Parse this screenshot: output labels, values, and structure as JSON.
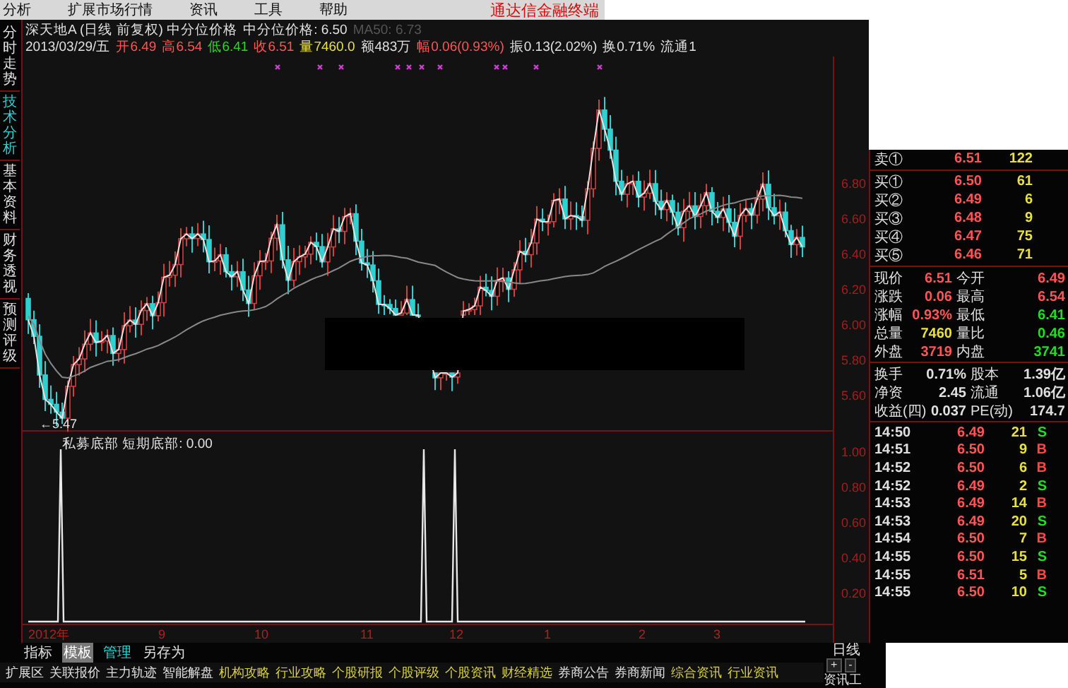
{
  "menu": {
    "items": [
      "分析",
      "扩展市场行情",
      "资讯",
      "工具",
      "帮助"
    ],
    "brand": "通达信金融终端"
  },
  "side_tabs": [
    {
      "label": "分时走势",
      "selected": false
    },
    {
      "label": "技术分析",
      "selected": true
    },
    {
      "label": "基本资料",
      "selected": false
    },
    {
      "label": "财务透视",
      "selected": false
    },
    {
      "label": "预测评级",
      "selected": false
    }
  ],
  "chart": {
    "title": "深天地A (日线 前复权) 中分位价格",
    "indicator_label": "中分位价格: 6.50",
    "ma_label": "MA50: 6.73",
    "bar_info": [
      {
        "text": "2013/03/29/五",
        "kind": "plain"
      },
      {
        "text": "开6.49",
        "kind": "up"
      },
      {
        "text": "高6.54",
        "kind": "up"
      },
      {
        "text": "低6.41",
        "kind": "down"
      },
      {
        "text": "收6.51",
        "kind": "up"
      },
      {
        "text": "量7460.0",
        "kind": "volume"
      },
      {
        "text": "额483万",
        "kind": "plain"
      },
      {
        "text": "幅0.06(0.93%)",
        "kind": "up"
      },
      {
        "text": "振0.13(2.02%)",
        "kind": "plain"
      },
      {
        "text": "换0.71%",
        "kind": "plain"
      },
      {
        "text": "流通1",
        "kind": "plain"
      }
    ],
    "price_ticks": [
      "6.80",
      "6.60",
      "6.40",
      "6.20",
      "6.00",
      "5.80",
      "5.60"
    ],
    "low_marker": "←5.47"
  },
  "indicator": {
    "title": "私募底部 短期底部: 0.00",
    "ticks": [
      "1.00",
      "0.80",
      "0.60",
      "0.40",
      "0.20"
    ]
  },
  "date_axis": [
    "2012年",
    "9",
    "10",
    "11",
    "12",
    "1",
    "2",
    "3"
  ],
  "chart_tabs": [
    {
      "label": "指标",
      "selected": false,
      "kind": "tab"
    },
    {
      "label": "模板",
      "selected": true,
      "kind": "tab"
    },
    {
      "label": "管理",
      "selected": false,
      "kind": "link"
    },
    {
      "label": "另存为",
      "selected": false,
      "kind": "tab"
    }
  ],
  "period": "日线",
  "zoom_buttons": [
    "+",
    "-"
  ],
  "asks": [
    {
      "label": "卖①",
      "price": "6.51",
      "volume": "122"
    }
  ],
  "bids": [
    {
      "label": "买①",
      "price": "6.50",
      "volume": "61"
    },
    {
      "label": "买②",
      "price": "6.49",
      "volume": "6"
    },
    {
      "label": "买③",
      "price": "6.48",
      "volume": "9"
    },
    {
      "label": "买④",
      "price": "6.47",
      "volume": "75"
    },
    {
      "label": "买⑤",
      "price": "6.46",
      "volume": "71"
    }
  ],
  "stats": [
    {
      "label": "现价",
      "value": "6.51",
      "color": "#ff5555"
    },
    {
      "label": "今开",
      "value": "6.49",
      "color": "#ff5555"
    },
    {
      "label": "涨跌",
      "value": "0.06",
      "color": "#ff5555"
    },
    {
      "label": "最高",
      "value": "6.54",
      "color": "#ff5555"
    },
    {
      "label": "涨幅",
      "value": "0.93%",
      "color": "#ff5555"
    },
    {
      "label": "最低",
      "value": "6.41",
      "color": "#22dd22"
    },
    {
      "label": "总量",
      "value": "7460",
      "color": "#e8e040"
    },
    {
      "label": "量比",
      "value": "0.46",
      "color": "#22dd22"
    },
    {
      "label": "外盘",
      "value": "3719",
      "color": "#ff5555"
    },
    {
      "label": "内盘",
      "value": "3741",
      "color": "#22dd22"
    }
  ],
  "fundamentals": [
    {
      "label": "换手",
      "value": "0.71%"
    },
    {
      "label": "股本",
      "value": "1.39亿"
    },
    {
      "label": "净资",
      "value": "2.45"
    },
    {
      "label": "流通",
      "value": "1.06亿"
    },
    {
      "label": "收益(四)",
      "value": "0.037"
    },
    {
      "label": "PE(动)",
      "value": "174.7"
    }
  ],
  "trades": [
    {
      "time": "14:50",
      "price": "6.49",
      "volume": "21",
      "side": "S"
    },
    {
      "time": "14:51",
      "price": "6.50",
      "volume": "9",
      "side": "B"
    },
    {
      "time": "14:52",
      "price": "6.50",
      "volume": "6",
      "side": "B"
    },
    {
      "time": "14:52",
      "price": "6.49",
      "volume": "2",
      "side": "S"
    },
    {
      "time": "14:53",
      "price": "6.49",
      "volume": "14",
      "side": "B"
    },
    {
      "time": "14:53",
      "price": "6.49",
      "volume": "20",
      "side": "S"
    },
    {
      "time": "14:54",
      "price": "6.50",
      "volume": "7",
      "side": "B"
    },
    {
      "time": "14:55",
      "price": "6.50",
      "volume": "15",
      "side": "S"
    },
    {
      "time": "14:55",
      "price": "6.51",
      "volume": "5",
      "side": "B"
    },
    {
      "time": "14:55",
      "price": "6.50",
      "volume": "10",
      "side": "S"
    }
  ],
  "bottom_bar": {
    "items": [
      {
        "label": "扩展区",
        "kind": "plain"
      },
      {
        "label": "关联报价",
        "kind": "plain"
      },
      {
        "label": "主力轨迹",
        "kind": "plain"
      },
      {
        "label": "智能解盘",
        "kind": "plain"
      },
      {
        "label": "机构攻略",
        "kind": "info"
      },
      {
        "label": "行业攻略",
        "kind": "info"
      },
      {
        "label": "个股研报",
        "kind": "info"
      },
      {
        "label": "个股评级",
        "kind": "info"
      },
      {
        "label": "个股资讯",
        "kind": "info"
      },
      {
        "label": "财经精选",
        "kind": "info"
      },
      {
        "label": "券商公告",
        "kind": "plain"
      },
      {
        "label": "券商新闻",
        "kind": "plain"
      },
      {
        "label": "综合资讯",
        "kind": "info"
      },
      {
        "label": "行业资讯",
        "kind": "info"
      }
    ],
    "right": "资讯工"
  }
}
